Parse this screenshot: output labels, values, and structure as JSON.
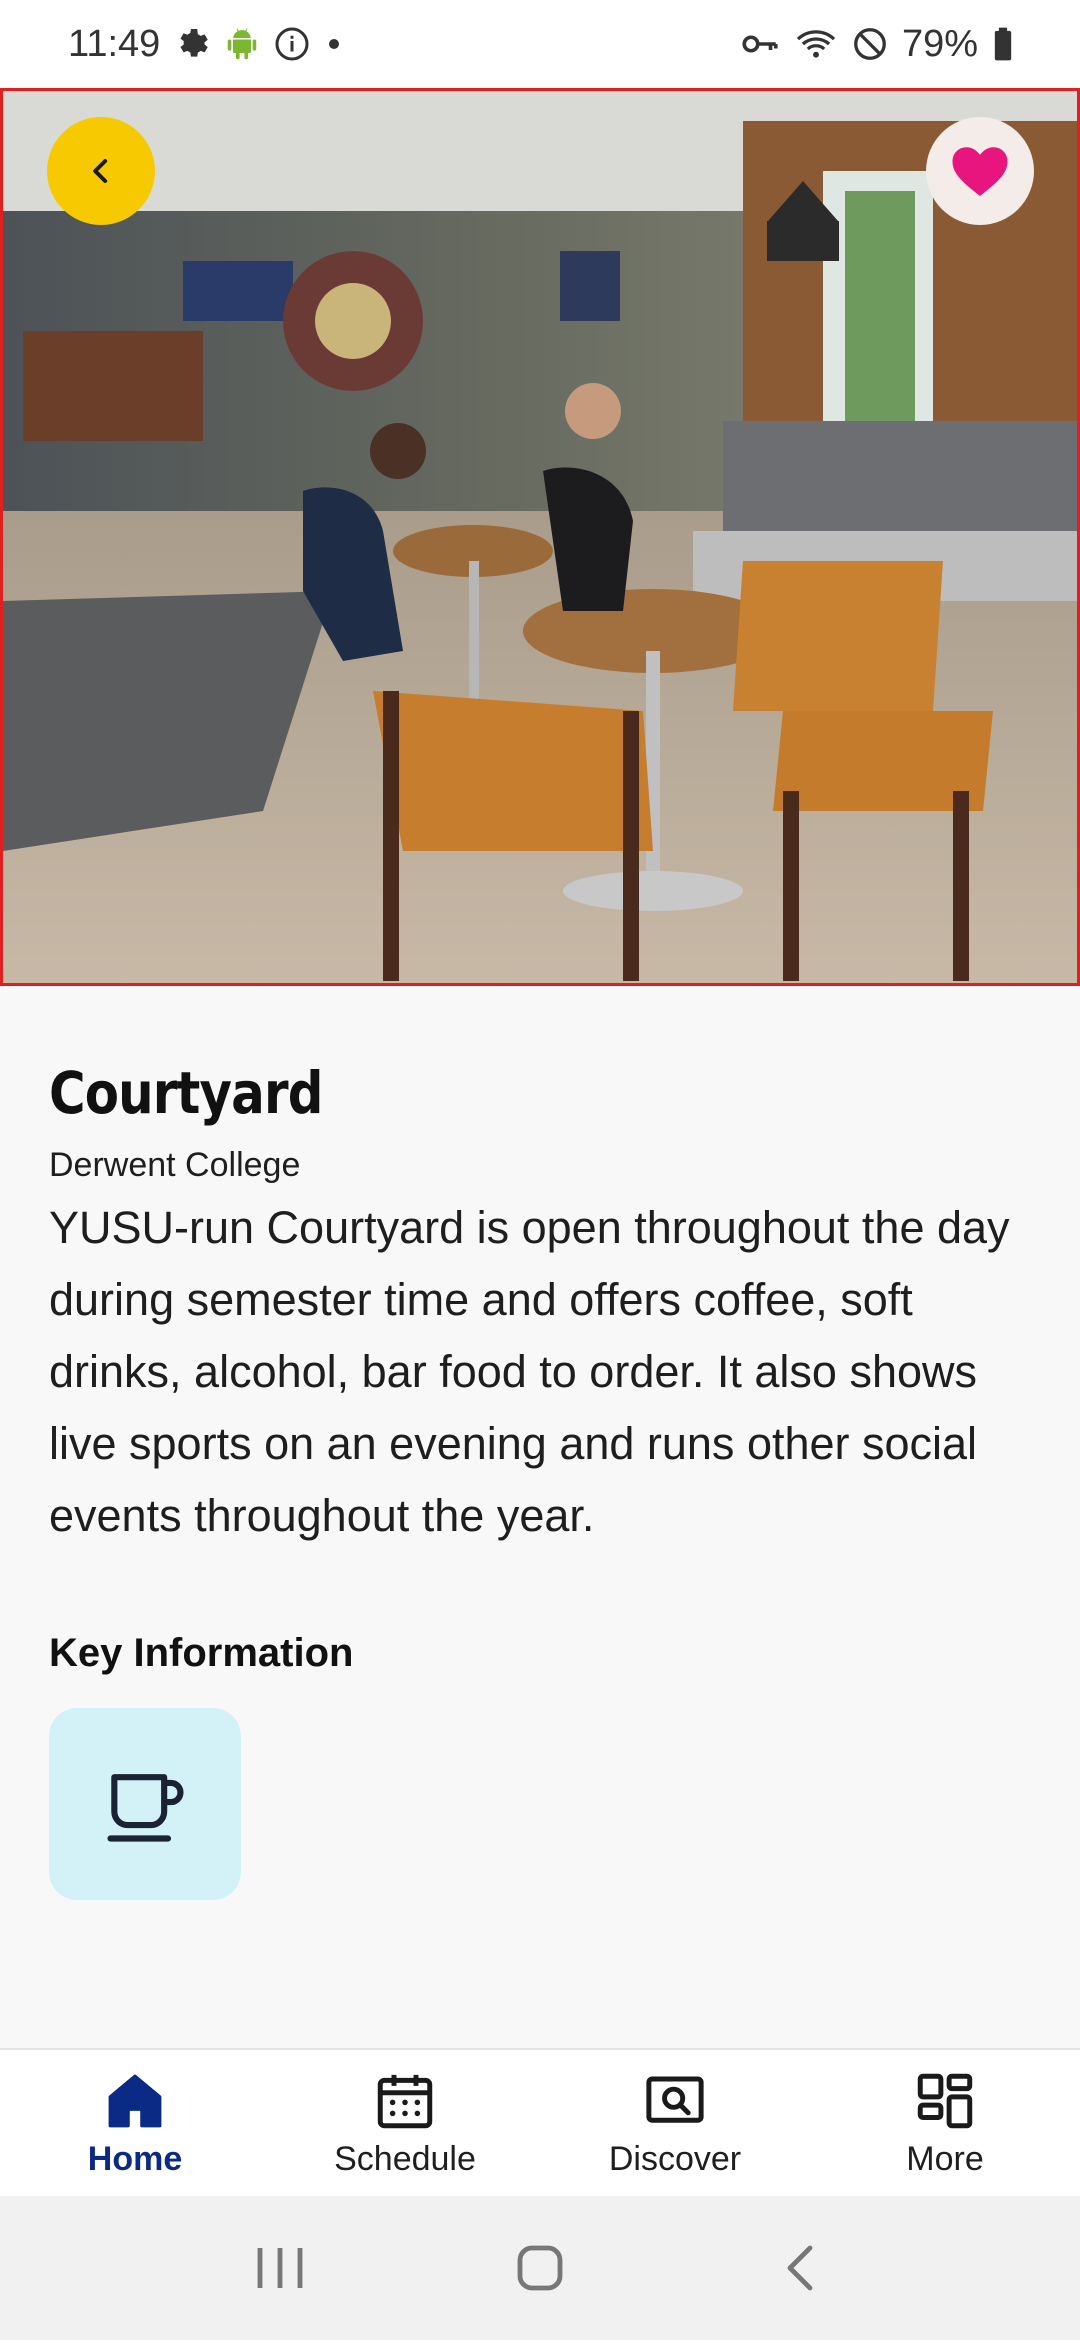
{
  "status_bar": {
    "time": "11:49",
    "battery_percent": "79%",
    "icons_left": [
      "gear-icon",
      "android-icon",
      "info-icon",
      "dot-icon"
    ],
    "icons_right": [
      "key-icon",
      "wifi-icon",
      "do-not-disturb-icon",
      "battery-icon"
    ]
  },
  "hero": {
    "image_alt": "Courtyard bar interior",
    "back_icon": "chevron-left-icon",
    "favorite_icon": "heart-icon",
    "accent_color": "#f6c900",
    "favorite_color": "#e8157f"
  },
  "venue": {
    "name": "Courtyard",
    "location": "Derwent College",
    "description": "YUSU-run Courtyard is open throughout the day during semester time and offers coffee, soft drinks, alcohol, bar food to order. It also shows live sports on an evening and runs other social events throughout the year."
  },
  "key_information": {
    "heading": "Key Information",
    "items": [
      {
        "icon": "coffee-cup-icon"
      }
    ]
  },
  "bottom_nav": {
    "items": [
      {
        "label": "Home",
        "icon": "home-icon",
        "active": true
      },
      {
        "label": "Schedule",
        "icon": "calendar-icon",
        "active": false
      },
      {
        "label": "Discover",
        "icon": "search-icon",
        "active": false
      },
      {
        "label": "More",
        "icon": "grid-icon",
        "active": false
      }
    ],
    "active_color": "#0b2a86"
  },
  "system_nav": {
    "icons": [
      "recents-icon",
      "home-circle-icon",
      "back-icon"
    ]
  }
}
